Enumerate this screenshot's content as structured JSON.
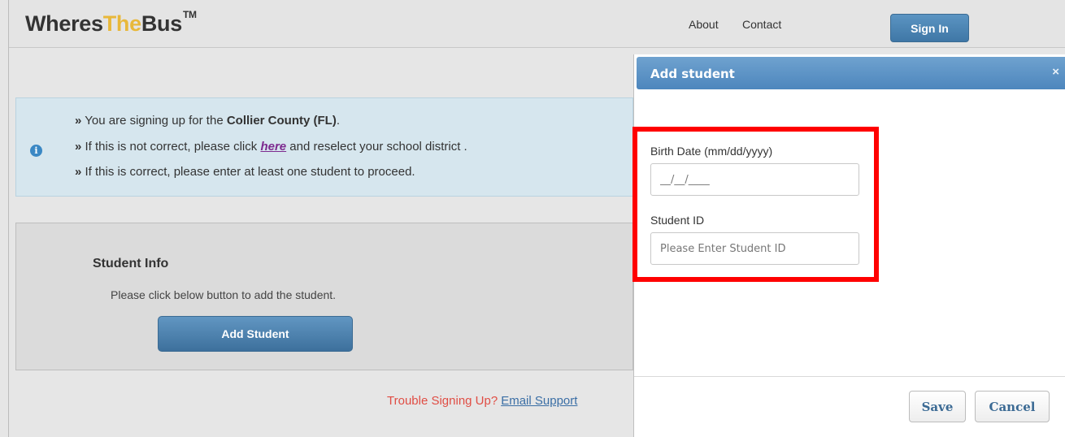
{
  "header": {
    "logo_part1": "Wheres",
    "logo_part2": "The",
    "logo_part3": "Bus",
    "logo_tm": "TM",
    "nav_about": "About",
    "nav_contact": "Contact",
    "signin_label": "Sign In"
  },
  "info": {
    "bullet": "»",
    "line1_prefix": "You are signing up for the ",
    "line1_bold": "Collier County (FL)",
    "line1_suffix": ".",
    "line2_prefix": "If this is not correct, please click ",
    "line2_link": "here",
    "line2_suffix": " and reselect your school district .",
    "line3": "If this is correct, please enter at least one student to proceed.",
    "icon": "i"
  },
  "student_info": {
    "title": "Student Info",
    "description": "Please click below button to add the student.",
    "add_button": "Add Student"
  },
  "support": {
    "text": "Trouble Signing Up?",
    "link": "Email Support"
  },
  "modal": {
    "title": "Add student",
    "close": "×",
    "birth_label": "Birth Date (mm/dd/yyyy)",
    "birth_placeholder": "__/__/____",
    "student_id_label": "Student ID",
    "student_id_placeholder": "Please Enter Student ID",
    "save": "Save",
    "cancel": "Cancel"
  },
  "colors": {
    "accent_blue": "#4d86bd",
    "logo_gold": "#e8b83a",
    "highlight_red": "#ff0000",
    "support_red": "#e04d44"
  }
}
